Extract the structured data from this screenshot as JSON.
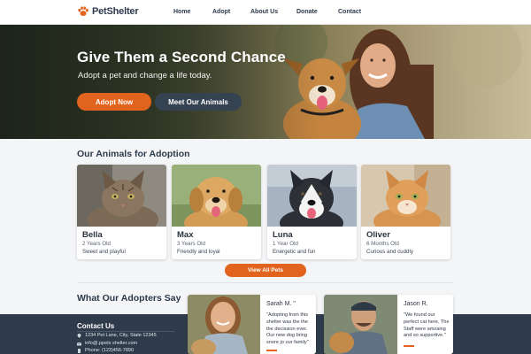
{
  "brand": {
    "name": "PetShelter",
    "accent": "#e2631d",
    "dark": "#344252"
  },
  "nav": {
    "links": [
      "Home",
      "Adopt",
      "About Us",
      "Donate",
      "Contact"
    ]
  },
  "hero": {
    "title": "Give Them a Second Chance",
    "subtitle": "Adopt a pet and change a life today.",
    "primary_button": "Adopt Now",
    "secondary_button": "Meet Our Animals"
  },
  "adoption": {
    "title": "Our Animals for Adoption",
    "animals": [
      {
        "name": "Bella",
        "age": "2 Years Old",
        "desc": "Sweet and playful"
      },
      {
        "name": "Max",
        "age": "3 Years Old",
        "desc": "Friendly and loyal"
      },
      {
        "name": "Luna",
        "age": "1 Year Old",
        "desc": "Energetic and fun"
      },
      {
        "name": "Oliver",
        "age": "6 Months Old",
        "desc": "Curious and cuddly"
      }
    ],
    "view_all": "View All Pets"
  },
  "testimonials": {
    "title": "What Our Adopters Say",
    "items": [
      {
        "name": "Sarah M. \"",
        "quote": [
          "\"Adopting from this",
          "shelter was the the",
          "the decission ever.",
          "Our new dog bring",
          "snore jo our family\""
        ]
      },
      {
        "name": "Jason R.",
        "quote": [
          "\"We found our",
          "perfect cat here. The",
          "Staff were amzaing",
          "and so supportive.\""
        ]
      }
    ]
  },
  "footer": {
    "contact_title": "Contact Us",
    "address": "1234 Pet Lane, City, State 12345",
    "email": "info@.ppets shelter.com",
    "phone": "Phone: (123)456-7890"
  }
}
